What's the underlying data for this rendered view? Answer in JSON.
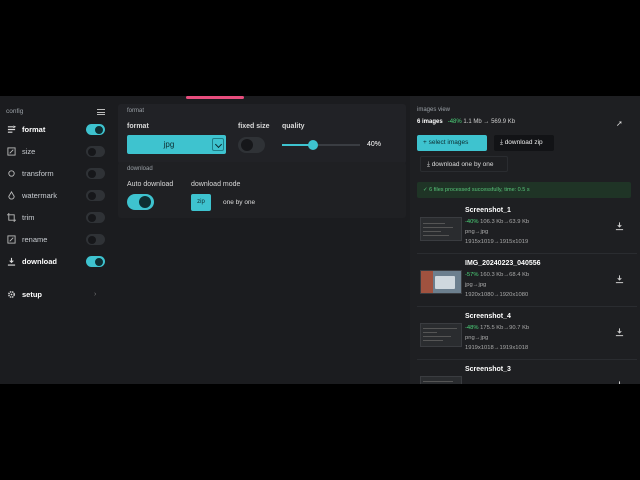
{
  "sidebar": {
    "title": "config",
    "items": [
      {
        "label": "format",
        "icon": "format-icon",
        "toggle": true,
        "active": true
      },
      {
        "label": "size",
        "icon": "resize-icon",
        "toggle": false,
        "active": false
      },
      {
        "label": "transform",
        "icon": "transform-icon",
        "toggle": false,
        "active": false
      },
      {
        "label": "watermark",
        "icon": "watermark-icon",
        "toggle": false,
        "active": false
      },
      {
        "label": "trim",
        "icon": "crop-icon",
        "toggle": false,
        "active": false
      },
      {
        "label": "rename",
        "icon": "rename-icon",
        "toggle": false,
        "active": false
      },
      {
        "label": "download",
        "icon": "download-icon",
        "toggle": true,
        "active": true
      }
    ],
    "setup_label": "setup"
  },
  "format_section": {
    "title": "format",
    "format_label": "format",
    "format_value": "jpg",
    "fixed_size_label": "fixed size",
    "fixed_size_on": false,
    "quality_label": "quality",
    "quality_value": "40%",
    "quality_fraction": 0.4
  },
  "download_section": {
    "title": "download",
    "auto_label": "Auto download",
    "auto_on": true,
    "mode_label": "download mode",
    "zip_label": "zip",
    "mode_value": "one by one"
  },
  "images_view": {
    "title": "images view",
    "count": "6 images",
    "saving": "-48%",
    "size_from": "1.1 Mb",
    "arrow": "→",
    "size_to": "569.9 Kb",
    "select_label": "select images",
    "zip_label": "download zip",
    "one_by_one_label": "download one by one",
    "success_message": "✓ 6 files processed successfully, time: 0.5 s",
    "files": [
      {
        "name": "Screenshot_1",
        "pct": "-40%",
        "size": "106.3 Kb→63.9 Kb",
        "fmt": "png→jpg",
        "dim": "1915x1019→1915x1019"
      },
      {
        "name": "IMG_20240223_040556",
        "pct": "-57%",
        "size": "160.3 Kb→68.4 Kb",
        "fmt": "jpg→jpg",
        "dim": "1920x1080→1920x1080"
      },
      {
        "name": "Screenshot_4",
        "pct": "-48%",
        "size": "175.5 Kb→90.7 Kb",
        "fmt": "png→jpg",
        "dim": "1919x1018→1919x1018"
      },
      {
        "name": "Screenshot_3",
        "pct": "",
        "size": "",
        "fmt": "",
        "dim": ""
      }
    ]
  },
  "colors": {
    "accent": "#3ec3cf",
    "top_accent": "#e84d7d",
    "success": "#4cd47a",
    "background": "#1b1c1f"
  }
}
